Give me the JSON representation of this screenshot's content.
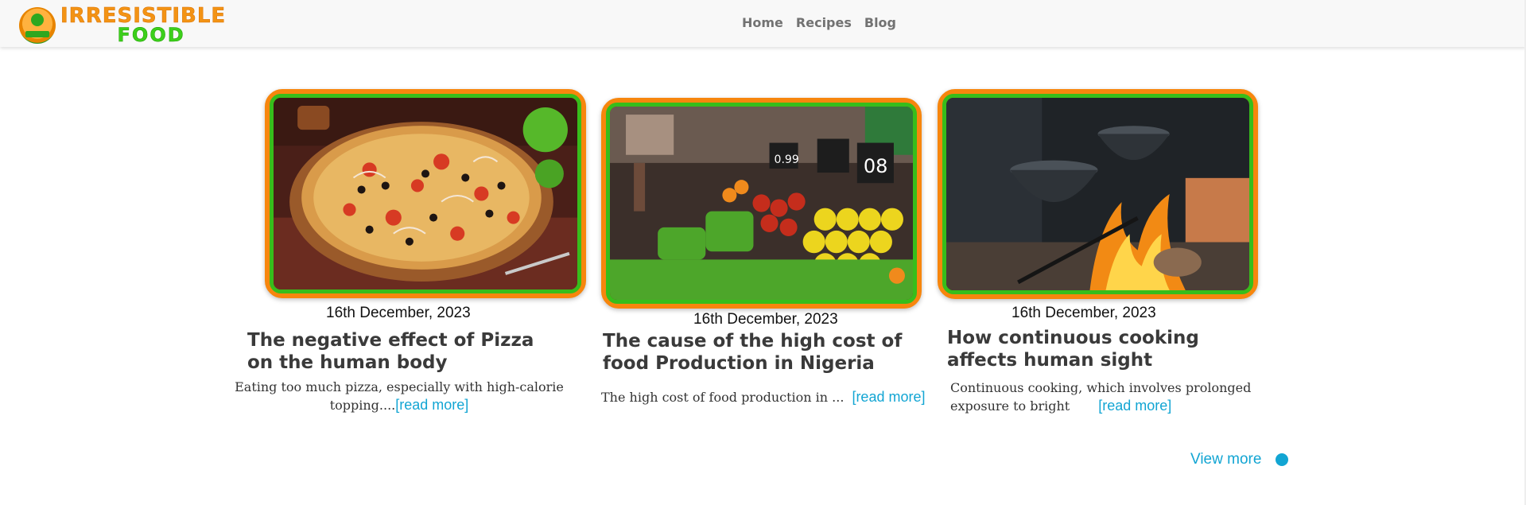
{
  "brand": {
    "line1": "IRRESISTIBLE",
    "line2": "FOOD",
    "colors": {
      "orange": "#f39314",
      "green": "#3ccf1b"
    }
  },
  "nav": {
    "items": [
      {
        "label": "Home"
      },
      {
        "label": "Recipes"
      },
      {
        "label": "Blog"
      }
    ]
  },
  "posts": [
    {
      "image": "pizza-photo",
      "date": "16th December, 2023",
      "title": "The negative effect of Pizza on the human body",
      "excerpt": "Eating too much pizza, especially with high-calorie topping....",
      "read_more": "[read more]"
    },
    {
      "image": "market-produce-photo",
      "date": "16th December, 2023",
      "title": "The cause of the high cost of food Production in Nigeria",
      "excerpt": "The high cost of food production in ...",
      "read_more": "[read more]"
    },
    {
      "image": "pot-over-fire-photo",
      "date": "16th December, 2023",
      "title": "How continuous cooking affects human sight",
      "excerpt": "Continuous cooking, which involves prolonged exposure to bright",
      "read_more": "[read more]"
    }
  ],
  "view_more": {
    "label": "View more"
  },
  "accent_color": "#12a5d3",
  "frame_colors": {
    "outer": "#f7860d",
    "inner": "#37bd1b"
  }
}
